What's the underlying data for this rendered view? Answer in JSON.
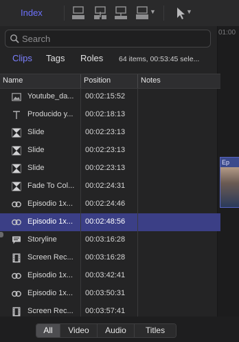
{
  "toolbar": {
    "index_label": "Index",
    "icons": [
      "clip-append-icon",
      "clip-insert-icon",
      "clip-connect-icon",
      "clip-overwrite-icon",
      "pointer-tool-icon"
    ]
  },
  "search": {
    "placeholder": "Search",
    "value": ""
  },
  "filter_tabs": [
    {
      "label": "Clips",
      "active": true
    },
    {
      "label": "Tags",
      "active": false
    },
    {
      "label": "Roles",
      "active": false
    }
  ],
  "item_count": "64 items, 00:53:45 sele...",
  "columns": {
    "name": "Name",
    "position": "Position",
    "notes": "Notes"
  },
  "rows": [
    {
      "icon": "image-icon",
      "name": "Youtube_da...",
      "position": "00:02:15:52",
      "selected": false
    },
    {
      "icon": "title-text-icon",
      "name": "Producido y...",
      "position": "00:02:18:13",
      "selected": false
    },
    {
      "icon": "transition-icon",
      "name": "Slide",
      "position": "00:02:23:13",
      "selected": false
    },
    {
      "icon": "transition-icon",
      "name": "Slide",
      "position": "00:02:23:13",
      "selected": false
    },
    {
      "icon": "transition-icon",
      "name": "Slide",
      "position": "00:02:23:13",
      "selected": false
    },
    {
      "icon": "transition-icon",
      "name": "Fade To Col...",
      "position": "00:02:24:31",
      "selected": false
    },
    {
      "icon": "compound-clip-icon",
      "name": "Episodio 1x...",
      "position": "00:02:24:46",
      "selected": false
    },
    {
      "icon": "compound-clip-icon",
      "name": "Episodio 1x...",
      "position": "00:02:48:56",
      "selected": true
    },
    {
      "icon": "storyline-icon",
      "name": "Storyline",
      "position": "00:03:16:28",
      "selected": false
    },
    {
      "icon": "film-icon",
      "name": "Screen Rec...",
      "position": "00:03:16:28",
      "selected": false
    },
    {
      "icon": "compound-clip-icon",
      "name": "Episodio 1x...",
      "position": "00:03:42:41",
      "selected": false
    },
    {
      "icon": "compound-clip-icon",
      "name": "Episodio 1x...",
      "position": "00:03:50:31",
      "selected": false
    },
    {
      "icon": "film-icon",
      "name": "Screen Rec...",
      "position": "00:03:57:41",
      "selected": false
    }
  ],
  "type_filter": [
    {
      "label": "All",
      "active": true
    },
    {
      "label": "Video",
      "active": false
    },
    {
      "label": "Audio",
      "active": false
    },
    {
      "label": "Titles",
      "active": false
    }
  ],
  "timeline_peek": {
    "timecode": "01:00",
    "clip_label": "Ep"
  },
  "colors": {
    "accent": "#6d72ff",
    "selection": "#3b3f86",
    "background": "#242425"
  }
}
